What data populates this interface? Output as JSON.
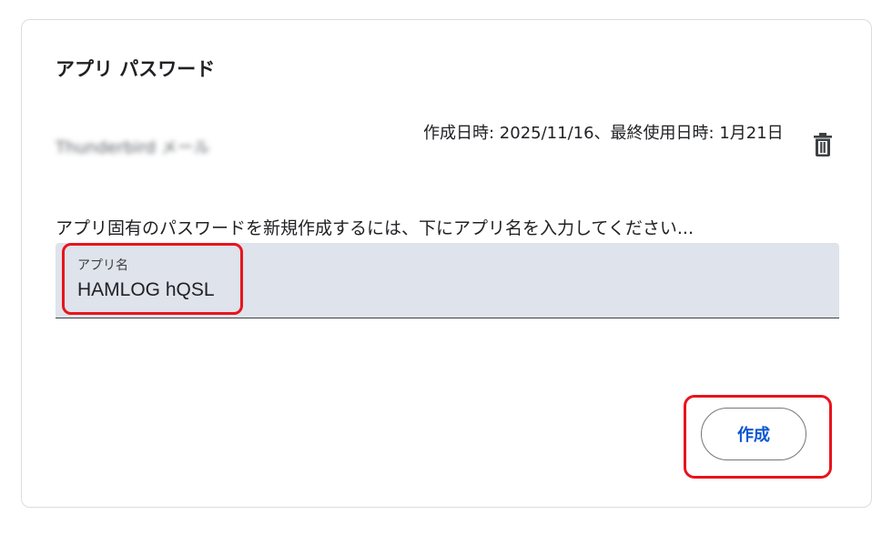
{
  "section": {
    "title": "アプリ パスワード"
  },
  "existing_password": {
    "name": "Thunderbird メール",
    "dates": "作成日時: 2025/11/16、最終使用日時: 1月21日",
    "delete_icon": "trash-icon"
  },
  "create_form": {
    "instruction": "アプリ固有のパスワードを新規作成するには、下にアプリ名を入力してください...",
    "field_label": "アプリ名",
    "field_value": "HAMLOG hQSL",
    "create_button_label": "作成"
  },
  "colors": {
    "highlight": "#e8141c",
    "field_background": "#dfe3eb",
    "button_text": "#0b57d0"
  }
}
